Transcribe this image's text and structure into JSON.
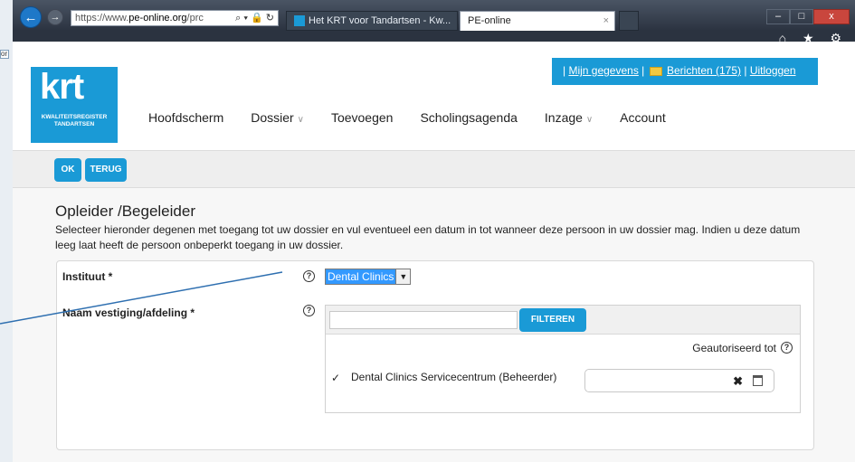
{
  "browser": {
    "back_label": "←",
    "forward_label": "→",
    "url_prefix": "https://www.",
    "url_domain": "pe-online.org",
    "url_suffix": "/prc",
    "url_controls": "⌕ ▾ 🔒 ↻",
    "tabs": [
      {
        "label": "Het KRT voor Tandartsen - Kw..."
      },
      {
        "label": "PE-online",
        "close": "×"
      }
    ],
    "window_controls": [
      "–",
      "□",
      "x"
    ],
    "toolbar_icons": "⌂ ★ ⚙"
  },
  "header": {
    "logo_text": "krt",
    "logo_subtext": "KWALITEITSREGISTER TANDARTSEN",
    "user_menu": {
      "mijn_gegevens": "Mijn gegevens",
      "berichten": "Berichten (175)",
      "uitloggen": "Uitloggen"
    },
    "nav": [
      {
        "label": "Hoofdscherm",
        "has_dropdown": false
      },
      {
        "label": "Dossier",
        "has_dropdown": true
      },
      {
        "label": "Toevoegen",
        "has_dropdown": false
      },
      {
        "label": "Scholingsagenda",
        "has_dropdown": false
      },
      {
        "label": "Inzage",
        "has_dropdown": true
      },
      {
        "label": "Account",
        "has_dropdown": false
      }
    ]
  },
  "actions": {
    "ok_label": "OK",
    "back_label": "TERUG"
  },
  "main": {
    "title": "Opleider /Begeleider",
    "intro": "Selecteer hieronder degenen met toegang tot uw dossier en vul eventueel een datum in tot wanneer deze persoon in uw dossier mag. Indien u deze datum leeg laat heeft de persoon onbeperkt toegang in uw dossier.",
    "form": {
      "instituut_label": "Instituut *",
      "instituut_value": "Dental Clinics",
      "vestiging_label": "Naam vestiging/afdeling *",
      "filter_value": "",
      "filter_button": "FILTEREN",
      "authorized_header": "Geautoriseerd tot",
      "rows": [
        {
          "checked": true,
          "label": "Dental Clinics Servicecentrum (Beheerder)",
          "date": ""
        }
      ]
    }
  },
  "colors": {
    "brand_blue": "#1a9ad6"
  }
}
